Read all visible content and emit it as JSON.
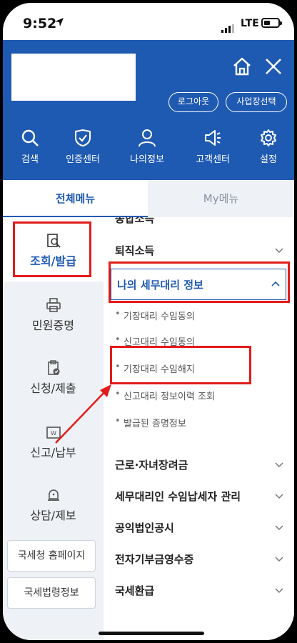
{
  "status_bar": {
    "time": "9:52",
    "carrier": "LTE"
  },
  "header": {
    "logout_label": "로그아웃",
    "business_select_label": "사업장선택",
    "quick_menu": [
      {
        "label": "검색",
        "icon": "search-icon"
      },
      {
        "label": "인증센터",
        "icon": "shield-check-icon"
      },
      {
        "label": "나의정보",
        "icon": "person-icon"
      },
      {
        "label": "고객센터",
        "icon": "megaphone-icon"
      },
      {
        "label": "설정",
        "icon": "gear-icon"
      }
    ]
  },
  "tabs": {
    "all": "전체메뉴",
    "my": "My메뉴"
  },
  "sidebar": {
    "items": [
      {
        "label": "조회/발급",
        "icon": "search-document-icon"
      },
      {
        "label": "민원증명",
        "icon": "printer-icon"
      },
      {
        "label": "신청/제출",
        "icon": "clipboard-check-icon"
      },
      {
        "label": "신고/납부",
        "icon": "won-receipt-icon"
      },
      {
        "label": "상담/제보",
        "icon": "bell-icon"
      }
    ],
    "links": [
      "국세청 홈페이지",
      "국세법령정보"
    ]
  },
  "menu": {
    "cut_label": "종합소득",
    "top_rows": [
      "퇴직소득"
    ],
    "expanded": {
      "label": "나의 세무대리 정보",
      "items": [
        "기장대리 수임동의",
        "신고대리 수임동의",
        "기장대리 수임해지",
        "신고대리 정보이력 조회",
        "발급된 증명정보"
      ]
    },
    "bottom_rows": [
      "근로·자녀장려금",
      "세무대리인 수임납세자 관리",
      "공익법인공시",
      "전자기부금영수증",
      "국세환급"
    ]
  },
  "colors": {
    "brand": "#1f5ab2",
    "highlight": "#e31b1b",
    "sidebar_bg": "#eef1f5"
  }
}
